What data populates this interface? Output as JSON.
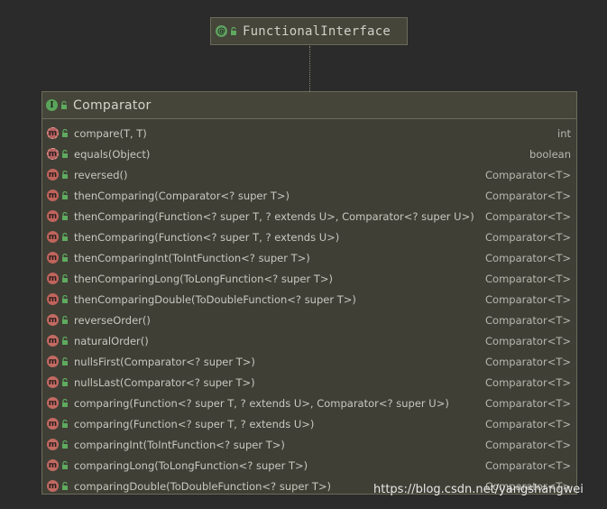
{
  "interface": {
    "name": "FunctionalInterface",
    "icon": "annotation-icon"
  },
  "class": {
    "name": "Comparator",
    "icon": "interface-icon"
  },
  "methods": [
    {
      "sig": "compare(T, T)",
      "ret": "int",
      "kind": "abstract"
    },
    {
      "sig": "equals(Object)",
      "ret": "boolean",
      "kind": "abstract"
    },
    {
      "sig": "reversed()",
      "ret": "Comparator<T>",
      "kind": "default"
    },
    {
      "sig": "thenComparing(Comparator<? super T>)",
      "ret": "Comparator<T>",
      "kind": "default"
    },
    {
      "sig": "thenComparing(Function<? super T, ? extends U>, Comparator<? super U>)",
      "ret": "Comparator<T>",
      "kind": "default"
    },
    {
      "sig": "thenComparing(Function<? super T, ? extends U>)",
      "ret": "Comparator<T>",
      "kind": "default"
    },
    {
      "sig": "thenComparingInt(ToIntFunction<? super T>)",
      "ret": "Comparator<T>",
      "kind": "default"
    },
    {
      "sig": "thenComparingLong(ToLongFunction<? super T>)",
      "ret": "Comparator<T>",
      "kind": "default"
    },
    {
      "sig": "thenComparingDouble(ToDoubleFunction<? super T>)",
      "ret": "Comparator<T>",
      "kind": "default"
    },
    {
      "sig": "reverseOrder()",
      "ret": "Comparator<T>",
      "kind": "static"
    },
    {
      "sig": "naturalOrder()",
      "ret": "Comparator<T>",
      "kind": "static"
    },
    {
      "sig": "nullsFirst(Comparator<? super T>)",
      "ret": "Comparator<T>",
      "kind": "static"
    },
    {
      "sig": "nullsLast(Comparator<? super T>)",
      "ret": "Comparator<T>",
      "kind": "static"
    },
    {
      "sig": "comparing(Function<? super T, ? extends U>, Comparator<? super U>)",
      "ret": "Comparator<T>",
      "kind": "static"
    },
    {
      "sig": "comparing(Function<? super T, ? extends U>)",
      "ret": "Comparator<T>",
      "kind": "static"
    },
    {
      "sig": "comparingInt(ToIntFunction<? super T>)",
      "ret": "Comparator<T>",
      "kind": "static"
    },
    {
      "sig": "comparingLong(ToLongFunction<? super T>)",
      "ret": "Comparator<T>",
      "kind": "static"
    },
    {
      "sig": "comparingDouble(ToDoubleFunction<? super T>)",
      "ret": "Comparator<T>",
      "kind": "static"
    }
  ],
  "watermark": "https://blog.csdn.net/yangshangwei",
  "colors": {
    "background": "#2b2b2b",
    "node_fill": "#3f3f36",
    "node_border": "#6b6b5a",
    "method_badge": "#c0645c",
    "interface_badge": "#5aa55a",
    "lock_icon": "#5faa5f"
  }
}
